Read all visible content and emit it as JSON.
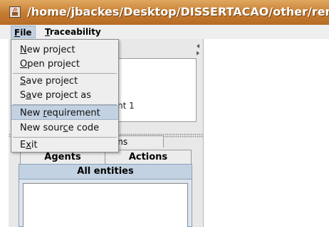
{
  "window": {
    "title": "/home/jbackes/Desktop/DISSERTACAO/other/rema",
    "icon": "java-app-icon"
  },
  "menubar": {
    "file_label": "File",
    "traceability_label": "Traceability"
  },
  "file_menu": {
    "items": [
      {
        "label": "New project",
        "mnemonic": "N"
      },
      {
        "label": "Open project",
        "mnemonic": "O"
      },
      {
        "label": "Save project",
        "mnemonic": "S"
      },
      {
        "label": "Save project as",
        "mnemonic": "a"
      },
      {
        "label": "New requirement",
        "mnemonic": "r"
      },
      {
        "label": "New source code",
        "mnemonic": "c"
      },
      {
        "label": "Exit",
        "mnemonic": "x"
      }
    ],
    "highlighted": "New requirement"
  },
  "left_panel": {
    "tree_item_partial": "nt 1",
    "tabs_row1_partial": "rictions",
    "tabs_row2": [
      "Agents",
      "Actions"
    ],
    "selected_tab": "All entities"
  },
  "colors": {
    "titlebar": "#c57b30",
    "selection": "#c3d2e2",
    "panel_bg": "#e8e8e8"
  }
}
